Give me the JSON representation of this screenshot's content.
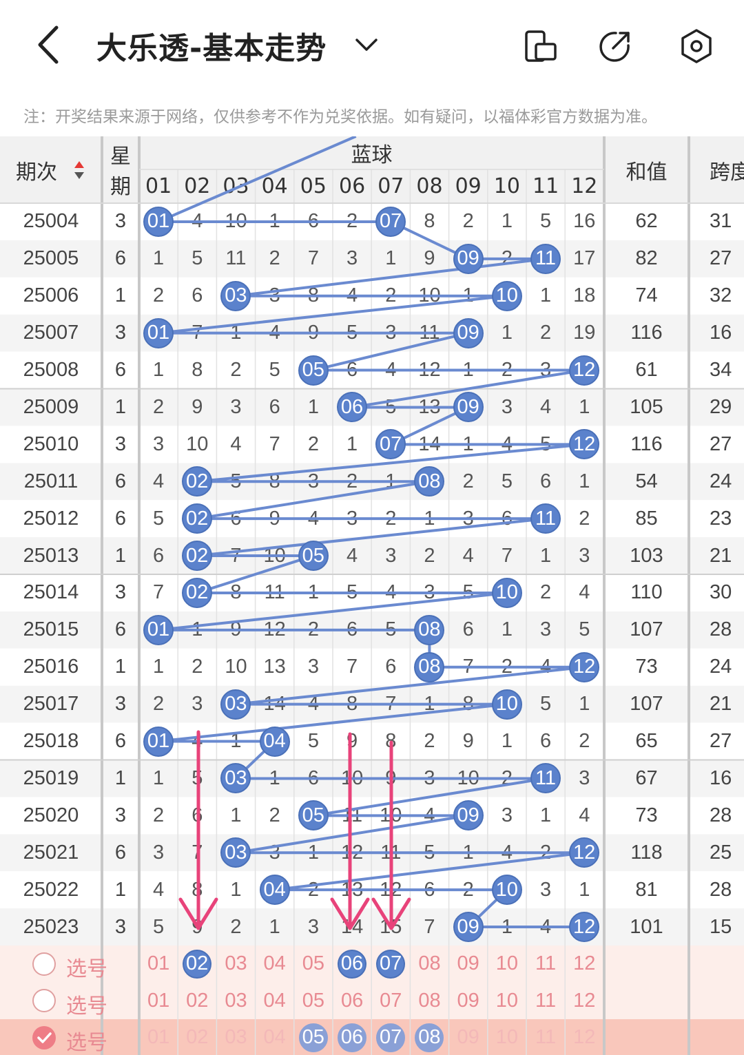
{
  "header": {
    "title": "大乐透-基本走势",
    "back_icon": "chevron-left-icon",
    "dropdown_icon": "chevron-down-icon",
    "actions": [
      "phone-rotate-icon",
      "share-icon",
      "settings-icon"
    ]
  },
  "notice": "注：开奖结果来源于网络，仅供参考不作为兑奖依据。如有疑问，以福体彩官方数据为准。",
  "table": {
    "col_period": "期次",
    "col_weekday_top": "星",
    "col_weekday_bottom": "期",
    "col_blue": "蓝球",
    "col_sum": "和值",
    "col_span": "跨度",
    "numbers": [
      "01",
      "02",
      "03",
      "04",
      "05",
      "06",
      "07",
      "08",
      "09",
      "10",
      "11",
      "12"
    ],
    "rows": [
      {
        "period": "25004",
        "weekday": "3",
        "cells": [
          "01",
          "4",
          "10",
          "1",
          "6",
          "2",
          "07",
          "8",
          "2",
          "1",
          "5",
          "16"
        ],
        "sum": "62",
        "span": "31"
      },
      {
        "period": "25005",
        "weekday": "6",
        "cells": [
          "1",
          "5",
          "11",
          "2",
          "7",
          "3",
          "1",
          "9",
          "09",
          "2",
          "11",
          "17"
        ],
        "sum": "82",
        "span": "27"
      },
      {
        "period": "25006",
        "weekday": "1",
        "cells": [
          "2",
          "6",
          "03",
          "3",
          "8",
          "4",
          "2",
          "10",
          "1",
          "10",
          "1",
          "18"
        ],
        "sum": "74",
        "span": "32"
      },
      {
        "period": "25007",
        "weekday": "3",
        "cells": [
          "01",
          "7",
          "1",
          "4",
          "9",
          "5",
          "3",
          "11",
          "09",
          "1",
          "2",
          "19"
        ],
        "sum": "116",
        "span": "16"
      },
      {
        "period": "25008",
        "weekday": "6",
        "cells": [
          "1",
          "8",
          "2",
          "5",
          "05",
          "6",
          "4",
          "12",
          "1",
          "2",
          "3",
          "12"
        ],
        "sum": "61",
        "span": "34"
      },
      {
        "period": "25009",
        "weekday": "1",
        "cells": [
          "2",
          "9",
          "3",
          "6",
          "1",
          "06",
          "5",
          "13",
          "09",
          "3",
          "4",
          "1"
        ],
        "sum": "105",
        "span": "29"
      },
      {
        "period": "25010",
        "weekday": "3",
        "cells": [
          "3",
          "10",
          "4",
          "7",
          "2",
          "1",
          "07",
          "14",
          "1",
          "4",
          "5",
          "12"
        ],
        "sum": "116",
        "span": "27"
      },
      {
        "period": "25011",
        "weekday": "6",
        "cells": [
          "4",
          "02",
          "5",
          "8",
          "3",
          "2",
          "1",
          "08",
          "2",
          "5",
          "6",
          "1"
        ],
        "sum": "54",
        "span": "24"
      },
      {
        "period": "25012",
        "weekday": "6",
        "cells": [
          "5",
          "02",
          "6",
          "9",
          "4",
          "3",
          "2",
          "1",
          "3",
          "6",
          "11",
          "2"
        ],
        "sum": "85",
        "span": "23"
      },
      {
        "period": "25013",
        "weekday": "1",
        "cells": [
          "6",
          "02",
          "7",
          "10",
          "05",
          "4",
          "3",
          "2",
          "4",
          "7",
          "1",
          "3"
        ],
        "sum": "103",
        "span": "21"
      },
      {
        "period": "25014",
        "weekday": "3",
        "cells": [
          "7",
          "02",
          "8",
          "11",
          "1",
          "5",
          "4",
          "3",
          "5",
          "10",
          "2",
          "4"
        ],
        "sum": "110",
        "span": "30"
      },
      {
        "period": "25015",
        "weekday": "6",
        "cells": [
          "01",
          "1",
          "9",
          "12",
          "2",
          "6",
          "5",
          "08",
          "6",
          "1",
          "3",
          "5"
        ],
        "sum": "107",
        "span": "28"
      },
      {
        "period": "25016",
        "weekday": "1",
        "cells": [
          "1",
          "2",
          "10",
          "13",
          "3",
          "7",
          "6",
          "08",
          "7",
          "2",
          "4",
          "12"
        ],
        "sum": "73",
        "span": "24"
      },
      {
        "period": "25017",
        "weekday": "3",
        "cells": [
          "2",
          "3",
          "03",
          "14",
          "4",
          "8",
          "7",
          "1",
          "8",
          "10",
          "5",
          "1"
        ],
        "sum": "107",
        "span": "21"
      },
      {
        "period": "25018",
        "weekday": "6",
        "cells": [
          "01",
          "4",
          "1",
          "04",
          "5",
          "9",
          "8",
          "2",
          "9",
          "1",
          "6",
          "2"
        ],
        "sum": "65",
        "span": "27"
      },
      {
        "period": "25019",
        "weekday": "1",
        "cells": [
          "1",
          "5",
          "03",
          "1",
          "6",
          "10",
          "9",
          "3",
          "10",
          "2",
          "11",
          "3"
        ],
        "sum": "67",
        "span": "16"
      },
      {
        "period": "25020",
        "weekday": "3",
        "cells": [
          "2",
          "6",
          "1",
          "2",
          "05",
          "11",
          "10",
          "4",
          "09",
          "3",
          "1",
          "4"
        ],
        "sum": "73",
        "span": "28"
      },
      {
        "period": "25021",
        "weekday": "6",
        "cells": [
          "3",
          "7",
          "03",
          "3",
          "1",
          "12",
          "11",
          "5",
          "1",
          "4",
          "2",
          "12"
        ],
        "sum": "118",
        "span": "25"
      },
      {
        "period": "25022",
        "weekday": "1",
        "cells": [
          "4",
          "8",
          "1",
          "04",
          "2",
          "13",
          "12",
          "6",
          "2",
          "10",
          "3",
          "1"
        ],
        "sum": "81",
        "span": "28"
      },
      {
        "period": "25023",
        "weekday": "3",
        "cells": [
          "5",
          "9",
          "2",
          "1",
          "3",
          "14",
          "15",
          "7",
          "09",
          "1",
          "4",
          "12"
        ],
        "sum": "101",
        "span": "15"
      }
    ],
    "hits": [
      1,
      9,
      3,
      1,
      5,
      6,
      7,
      8,
      11,
      8,
      9,
      10,
      2,
      11,
      2,
      2,
      2,
      10,
      1,
      8,
      8,
      12,
      10,
      1,
      4,
      3,
      11,
      5,
      9,
      3,
      12,
      4,
      10,
      9,
      12
    ],
    "hits_per_row": [
      [
        1,
        7
      ],
      [
        9,
        11
      ],
      [
        3,
        10
      ],
      [
        1,
        9
      ],
      [
        5,
        12
      ],
      [
        6,
        9
      ],
      [
        7,
        12
      ],
      [
        2,
        8
      ],
      [
        2,
        11
      ],
      [
        2,
        5
      ],
      [
        2,
        10
      ],
      [
        1,
        8
      ],
      [
        8,
        12
      ],
      [
        3,
        10
      ],
      [
        1,
        4
      ],
      [
        3,
        11
      ],
      [
        5,
        9
      ],
      [
        3,
        12
      ],
      [
        4,
        10
      ],
      [
        9,
        12
      ]
    ]
  },
  "selectors": [
    {
      "label": "选号",
      "checked": false,
      "selected": [
        "02",
        "06",
        "07"
      ],
      "tone": "light"
    },
    {
      "label": "选号",
      "checked": false,
      "selected": [],
      "tone": "light"
    },
    {
      "label": "选号",
      "checked": true,
      "selected": [
        "05",
        "06",
        "07",
        "08"
      ],
      "tone": "dark"
    }
  ],
  "colors": {
    "ball": "#5b82cc",
    "line": "#6a8ad0",
    "arrow": "#e8437a",
    "grid_shade": "#f3f3f3",
    "select_bg": "#fdeeea",
    "select_bg_checked": "#f9c7bb",
    "pink_text": "#e88a92"
  }
}
